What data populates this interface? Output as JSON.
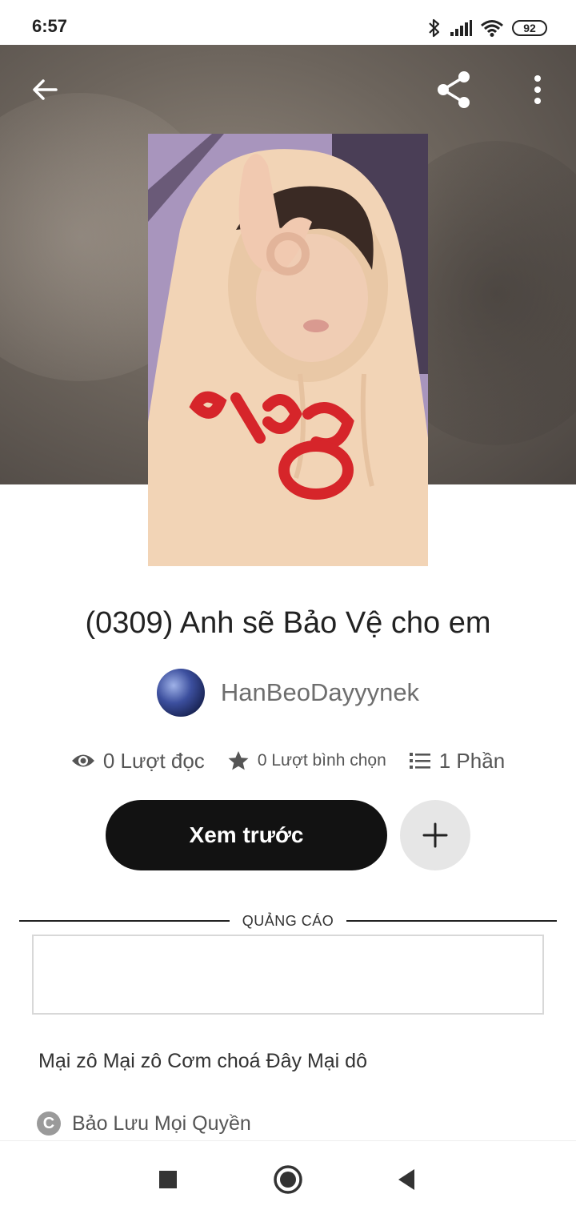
{
  "status_bar": {
    "time": "6:57",
    "battery": "92",
    "icons": [
      "bluetooth-icon",
      "signal-icon",
      "wifi-icon",
      "battery-icon"
    ]
  },
  "toolbar": {
    "back_icon": "arrow-left-icon",
    "share_icon": "share-icon",
    "more_icon": "more-vertical-icon"
  },
  "story": {
    "title": "(0309) Anh sẽ Bảo Vệ cho em",
    "author": "HanBeoDayyynek",
    "stats": {
      "reads": "0 Lượt đọc",
      "votes": "0 Lượt bình chọn",
      "parts": "1 Phần"
    },
    "description": "Mại zô Mại zô Cơm choá Đây Mại dô",
    "copyright": "Bảo Lưu Mọi Quyền"
  },
  "actions": {
    "read_label": "Xem trước",
    "add_icon": "plus-icon"
  },
  "ad": {
    "label": "QUẢNG CÁO"
  },
  "nav": {
    "recents_icon": "square-icon",
    "home_icon": "circle-icon",
    "back_icon": "triangle-back-icon"
  },
  "colors": {
    "primary_button": "#121212",
    "add_button": "#e6e6e6",
    "muted_text": "#6e6e6e"
  }
}
